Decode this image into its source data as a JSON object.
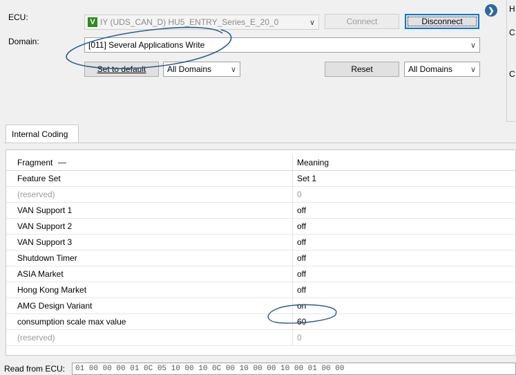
{
  "ecu": {
    "label": "ECU:",
    "badge": "V",
    "value": "IY (UDS_CAN_D) HU5_ENTRY_Series_E_20_0",
    "connect_label": "Connect",
    "disconnect_label": "Disconnect"
  },
  "domain": {
    "label": "Domain:",
    "value": "[011] Several Applications Write"
  },
  "controls": {
    "set_default_label": "Set to default",
    "filter_left": "All Domains",
    "reset_label": "Reset",
    "filter_right": "All Domains"
  },
  "side_panel": {
    "letters": [
      "H",
      "C",
      "C"
    ]
  },
  "tabs": [
    {
      "label": "Internal Coding"
    }
  ],
  "grid": {
    "columns": [
      "Fragment",
      "Meaning"
    ],
    "rows": [
      {
        "fragment": "Feature Set",
        "meaning": "Set 1",
        "dim": false
      },
      {
        "fragment": "(reserved)",
        "meaning": "0",
        "dim": true
      },
      {
        "fragment": "VAN Support 1",
        "meaning": "off",
        "dim": false
      },
      {
        "fragment": "VAN Support 2",
        "meaning": "off",
        "dim": false
      },
      {
        "fragment": "VAN Support 3",
        "meaning": "off",
        "dim": false
      },
      {
        "fragment": "Shutdown Timer",
        "meaning": "off",
        "dim": false
      },
      {
        "fragment": "ASIA Market",
        "meaning": "off",
        "dim": false
      },
      {
        "fragment": "Hong Kong Market",
        "meaning": "off",
        "dim": false
      },
      {
        "fragment": "AMG Design Variant",
        "meaning": "on",
        "dim": false
      },
      {
        "fragment": "consumption scale max value",
        "meaning": "60",
        "dim": false
      },
      {
        "fragment": "(reserved)",
        "meaning": "0",
        "dim": true
      }
    ]
  },
  "footer": {
    "read_label": "Read from ECU:",
    "read_value": "01 00 00 00 01 0C 05 10 00 10 0C 00 10 00 00 10 00 01 00 00"
  },
  "colors": {
    "annotation_ink": "#2a5d8f",
    "ecu_badge": "#2e8b1a",
    "accent": "#0078d7",
    "nav_icon": "#2b6aa0"
  }
}
